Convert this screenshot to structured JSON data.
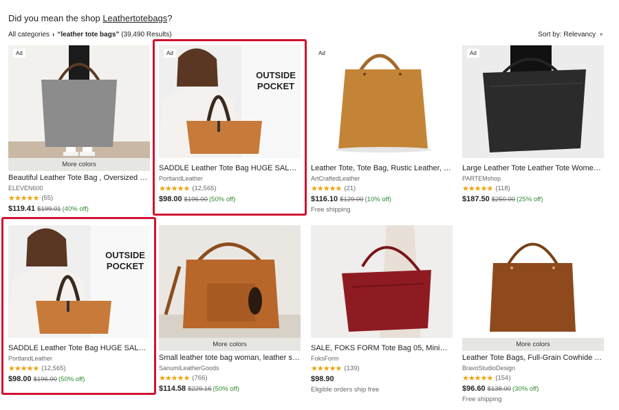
{
  "did_you_mean": {
    "prefix": "Did you mean the shop ",
    "shop": "Leathertotebags",
    "suffix": "?"
  },
  "breadcrumb": {
    "all": "All categories",
    "query": "“leather tote bags”",
    "results": "(39,490 Results)"
  },
  "sort": {
    "label": "Sort by: Relevancy"
  },
  "cards": [
    {
      "ad": "Ad",
      "more_colors": "More colors",
      "title": "Beautiful Leather Tote Bag , Oversized Leather...",
      "shop": "ELEVEN600",
      "stars": "★★★★★",
      "rating_count": "(55)",
      "price": "$119.41",
      "was": "$199.01",
      "off": "(40% off)",
      "note": ""
    },
    {
      "ad": "Ad",
      "more_colors": "",
      "title": "SADDLE Leather Tote Bag HUGE SALE -...",
      "shop": "PortlandLeather",
      "stars": "★★★★★",
      "rating_count": "(12,565)",
      "price": "$98.00",
      "was": "$196.00",
      "off": "(50% off)",
      "note": "",
      "overlay": [
        "OUTSIDE",
        "POCKET"
      ]
    },
    {
      "ad": "Ad",
      "more_colors": "",
      "title": "Leather Tote, Tote Bag, Rustic Leather, Leather...",
      "shop": "ArtCraftedLeather",
      "stars": "★★★★★",
      "rating_count": "(21)",
      "price": "$116.10",
      "was": "$129.00",
      "off": "(10% off)",
      "note": "Free shipping"
    },
    {
      "ad": "Ad",
      "more_colors": "",
      "title": "Large Leather Tote Leather Tote Women Leather...",
      "shop": "PARTEMshop",
      "stars": "★★★★★",
      "rating_count": "(118)",
      "price": "$187.50",
      "was": "$250.00",
      "off": "(25% off)",
      "note": ""
    },
    {
      "ad": "",
      "more_colors": "",
      "title": "SADDLE Leather Tote Bag HUGE SALE -...",
      "shop": "PortlandLeather",
      "stars": "★★★★★",
      "rating_count": "(12,565)",
      "price": "$98.00",
      "was": "$196.00",
      "off": "(50% off)",
      "note": "",
      "overlay": [
        "OUTSIDE",
        "POCKET"
      ]
    },
    {
      "ad": "",
      "more_colors": "More colors",
      "title": "Small leather tote bag woman, leather shoulder...",
      "shop": "SanumiLeatherGoods",
      "stars": "★★★★★",
      "rating_count": "(766)",
      "price": "$114.58",
      "was": "$229.16",
      "off": "(50% off)",
      "note": ""
    },
    {
      "ad": "",
      "more_colors": "",
      "title": "SALE, FOKS FORM Tote Bag 05, Minimalist Leather...",
      "shop": "FoksForm",
      "stars": "★★★★★",
      "rating_count": "(139)",
      "price": "$98.90",
      "was": "",
      "off": "",
      "note": "Eligible orders ship free"
    },
    {
      "ad": "",
      "more_colors": "More colors",
      "title": "Leather Tote Bags, Full-Grain Cowhide Tote Bag...",
      "shop": "BravoStudioDesign",
      "stars": "★★★★★",
      "rating_count": "(154)",
      "price": "$96.60",
      "was": "$138.00",
      "off": "(30% off)",
      "note": "Free shipping"
    }
  ]
}
